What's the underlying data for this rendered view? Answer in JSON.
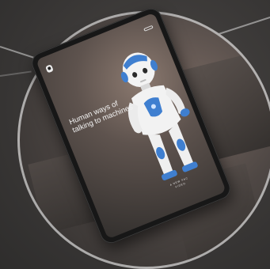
{
  "hero": {
    "headline_line1": "Human ways of",
    "headline_line2": "talking to machines",
    "cta_line1": "A NEW FAC",
    "cta_line2": "VIDEO"
  },
  "nav": {
    "item1": "",
    "item2": "",
    "cta": ""
  },
  "colors": {
    "background": "#3b3a39",
    "ring": "#d2d2d2",
    "robot_accent": "#3f7fd0",
    "robot_body": "#f2f2f2"
  },
  "icons": {
    "logo": "robot-logo-icon"
  }
}
